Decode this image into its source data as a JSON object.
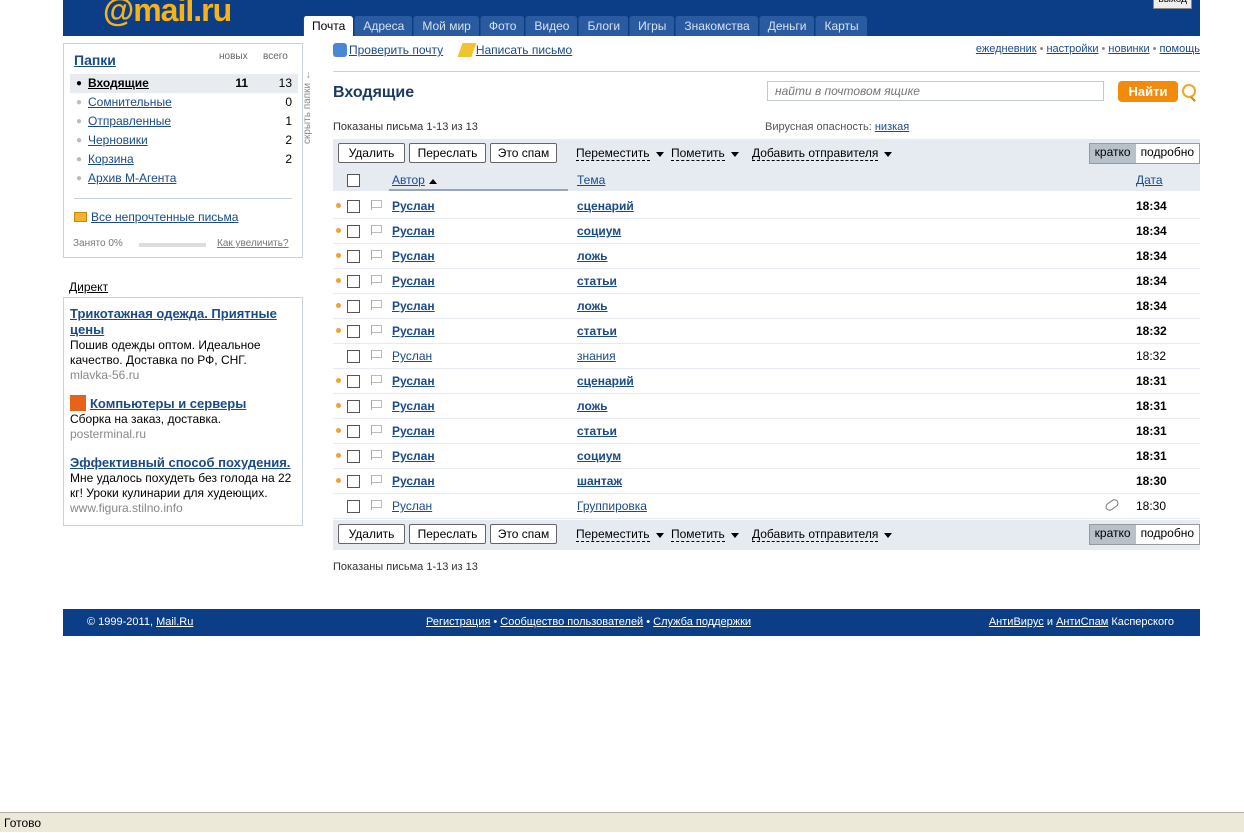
{
  "header": {
    "logo": "@mail.ru",
    "tabs": [
      "Почта",
      "Адреса",
      "Мой мир",
      "Фото",
      "Видео",
      "Блоги",
      "Игры",
      "Знакомства",
      "Деньги",
      "Карты"
    ],
    "exit_label": "выход"
  },
  "folders": {
    "title": "Папки",
    "col_new": "новых",
    "col_total": "всего",
    "items": [
      {
        "name": "Входящие",
        "new": "11",
        "total": "13"
      },
      {
        "name": "Сомнительные",
        "new": "",
        "total": "0"
      },
      {
        "name": "Отправленные",
        "new": "",
        "total": "1"
      },
      {
        "name": "Черновики",
        "new": "",
        "total": "2"
      },
      {
        "name": "Корзина",
        "new": "",
        "total": "2"
      },
      {
        "name": "Архив М-Агента",
        "new": "",
        "total": ""
      }
    ],
    "unread_link": "Все непрочтенные письма",
    "used": "Занято 0%",
    "increase_link": "Как увеличить?",
    "hide_label": "скрыть папки"
  },
  "direct": {
    "title": "Директ",
    "ads": [
      {
        "headline": "Трикотажная одежда. Приятные цены",
        "text": "Пошив одежды оптом. Идеальное качество. Доставка по РФ, СНГ.",
        "url": "mlavka-56.ru"
      },
      {
        "headline": "Компьютеры и серверы",
        "text": "Сборка на заказ, доставка.",
        "url": "posterminal.ru"
      },
      {
        "headline": "Эффективный способ похудения.",
        "text": "Мне удалось похудеть без голода на 22 кг! Уроки кулинарии для худеющих.",
        "url": "www.figura.stilno.info"
      }
    ]
  },
  "actions": {
    "check_mail": "Проверить почту",
    "write": "Написать письмо",
    "right_links": [
      "ежедневник",
      "настройки",
      "новинки",
      "помощь"
    ]
  },
  "inbox": {
    "title": "Входящие",
    "search_placeholder": "найти в почтовом ящике",
    "search_button": "Найти",
    "shown": "Показаны письма 1-13 из 13",
    "virus_label": "Вирусная опасность:",
    "virus_level": "низкая"
  },
  "toolbar": {
    "delete": "Удалить",
    "forward": "Переслать",
    "spam": "Это спам",
    "move": "Переместить",
    "mark": "Пометить",
    "add_sender": "Добавить отправителя",
    "view_short": "кратко",
    "view_detail": "подробно"
  },
  "table": {
    "col_author": "Автор",
    "col_subject": "Тема",
    "col_date": "Дата",
    "rows": [
      {
        "from": "Руслан",
        "subject": "сценарий",
        "time": "18:34",
        "unread": true
      },
      {
        "from": "Руслан",
        "subject": "социум",
        "time": "18:34",
        "unread": true
      },
      {
        "from": "Руслан",
        "subject": "ложь",
        "time": "18:34",
        "unread": true
      },
      {
        "from": "Руслан",
        "subject": "статьи",
        "time": "18:34",
        "unread": true
      },
      {
        "from": "Руслан",
        "subject": "ложь",
        "time": "18:34",
        "unread": true
      },
      {
        "from": "Руслан",
        "subject": "статьи",
        "time": "18:32",
        "unread": true
      },
      {
        "from": "Руслан",
        "subject": "знания",
        "time": "18:32",
        "unread": false
      },
      {
        "from": "Руслан",
        "subject": "сценарий",
        "time": "18:31",
        "unread": true
      },
      {
        "from": "Руслан",
        "subject": "ложь",
        "time": "18:31",
        "unread": true
      },
      {
        "from": "Руслан",
        "subject": "статьи",
        "time": "18:31",
        "unread": true
      },
      {
        "from": "Руслан",
        "subject": "социум",
        "time": "18:31",
        "unread": true
      },
      {
        "from": "Руслан",
        "subject": "шантаж",
        "time": "18:30",
        "unread": true
      },
      {
        "from": "Руслан",
        "subject": "Группировка",
        "time": "18:30",
        "unread": false,
        "attachment": true
      }
    ]
  },
  "footer": {
    "copyright": "© 1999-2011,",
    "copyright_link": "Mail.Ru",
    "links": [
      "Регистрация",
      "Сообщество пользователей",
      "Служба поддержки"
    ],
    "antivirus": "АнтиВирус",
    "and": "и",
    "antispam": "АнтиСпам",
    "kaspersky": "Касперского"
  },
  "statusbar": "Готово"
}
